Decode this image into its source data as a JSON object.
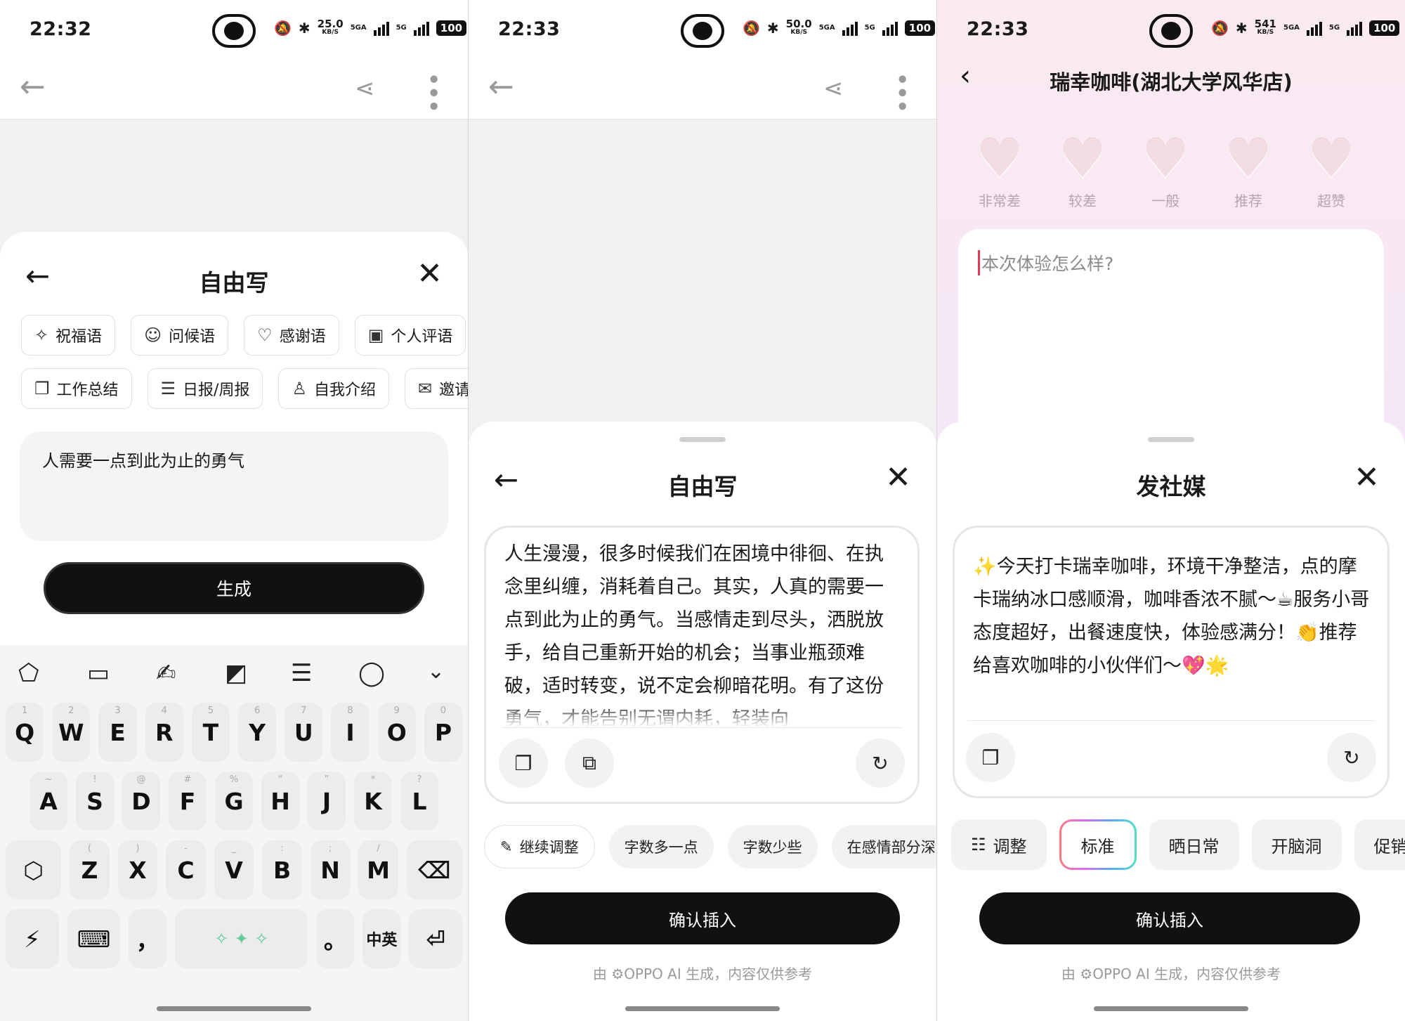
{
  "colors": {
    "accent_dark": "#111111",
    "cursor": "#e23a5b",
    "muted": "#9a9a9a"
  },
  "panel1": {
    "status": {
      "time": "22:32",
      "speed": "25.0",
      "speed_unit": "KB/S",
      "net1": "5GA",
      "net2": "5G",
      "battery": "100"
    },
    "sheet_title": "自由写",
    "chips_row1": [
      {
        "icon": "magic-wand-icon",
        "label": "祝福语"
      },
      {
        "icon": "greeting-icon",
        "label": "问候语"
      },
      {
        "icon": "heart-message-icon",
        "label": "感谢语"
      },
      {
        "icon": "profile-card-icon",
        "label": "个人评语"
      }
    ],
    "chips_row2": [
      {
        "icon": "document-icon",
        "label": "工作总结"
      },
      {
        "icon": "report-icon",
        "label": "日报/周报"
      },
      {
        "icon": "person-icon",
        "label": "自我介绍"
      },
      {
        "icon": "mail-icon",
        "label": "邀请函"
      }
    ],
    "input_value": "人需要一点到此为止的勇气",
    "generate_label": "生成",
    "keyboard": {
      "row1": [
        {
          "k": "Q",
          "n": "1"
        },
        {
          "k": "W",
          "n": "2"
        },
        {
          "k": "E",
          "n": "3"
        },
        {
          "k": "R",
          "n": "4"
        },
        {
          "k": "T",
          "n": "5"
        },
        {
          "k": "Y",
          "n": "6"
        },
        {
          "k": "U",
          "n": "7"
        },
        {
          "k": "I",
          "n": "8"
        },
        {
          "k": "O",
          "n": "9"
        },
        {
          "k": "P",
          "n": "0"
        }
      ],
      "row2": [
        {
          "k": "A",
          "n": "~"
        },
        {
          "k": "S",
          "n": "!"
        },
        {
          "k": "D",
          "n": "@"
        },
        {
          "k": "F",
          "n": "#"
        },
        {
          "k": "G",
          "n": "%"
        },
        {
          "k": "H",
          "n": "“"
        },
        {
          "k": "J",
          "n": "”"
        },
        {
          "k": "K",
          "n": "*"
        },
        {
          "k": "L",
          "n": "?"
        }
      ],
      "row3": [
        {
          "k": "Z",
          "n": "("
        },
        {
          "k": "X",
          "n": ")"
        },
        {
          "k": "C",
          "n": "-"
        },
        {
          "k": "V",
          "n": "_"
        },
        {
          "k": "B",
          "n": ":"
        },
        {
          "k": "N",
          "n": ";"
        },
        {
          "k": "M",
          "n": "/"
        }
      ],
      "comma": "，",
      "period": "。",
      "lang": "中英"
    }
  },
  "panel2": {
    "status": {
      "time": "22:33",
      "speed": "50.0",
      "speed_unit": "KB/S",
      "net1": "5GA",
      "net2": "5G",
      "battery": "100"
    },
    "sheet_title": "自由写",
    "result_text": "人生漫漫，很多时候我们在困境中徘徊、在执念里纠缠，消耗着自己。其实，人真的需要一点到此为止的勇气。当感情走到尽头，洒脱放手，给自己重新开始的机会；当事业瓶颈难破，适时转变，说不定会柳暗花明。有了这份勇气，才能告别无谓内耗，轻装向",
    "chips": [
      "继续调整",
      "字数多一点",
      "字数少些",
      "在感情部分深入"
    ],
    "confirm_label": "确认插入",
    "footnote": "由 ⚙OPPO AI 生成，内容仅供参考"
  },
  "panel3": {
    "status": {
      "time": "22:33",
      "speed": "541",
      "speed_unit": "KB/S",
      "net1": "5GA",
      "net2": "5G",
      "battery": "100"
    },
    "store_title": "瑞幸咖啡(湖北大学风华店)",
    "ratings": [
      "非常差",
      "较差",
      "一般",
      "推荐",
      "超赞"
    ],
    "review_placeholder": "本次体验怎么样?",
    "sheet_title": "发社媒",
    "social_text": "✨今天打卡瑞幸咖啡，环境干净整洁，点的摩卡瑞纳冰口感顺滑，咖啡香浓不腻～☕服务小哥态度超好，出餐速度快，体验感满分！👏推荐给喜欢咖啡的小伙伴们～💖🌟",
    "styles": [
      "调整",
      "标准",
      "晒日常",
      "开脑洞",
      "促销"
    ],
    "confirm_label": "确认插入",
    "footnote": "由 ⚙OPPO AI 生成，内容仅供参考"
  }
}
